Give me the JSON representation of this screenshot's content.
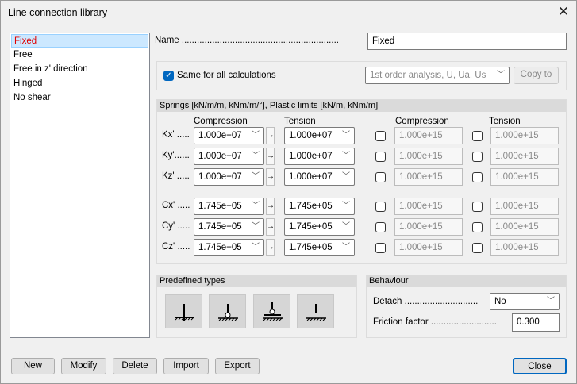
{
  "window": {
    "title": "Line connection library"
  },
  "list": {
    "items": [
      "Fixed",
      "Free",
      "Free in z' direction",
      "Hinged",
      "No shear"
    ],
    "selected": 0
  },
  "name": {
    "label": "Name ..............................................................",
    "value": "Fixed"
  },
  "calc": {
    "same_label": "Same for all calculations",
    "same_checked": true,
    "analysis": "1st order analysis, U, Ua, Us",
    "copy_to": "Copy to"
  },
  "springs": {
    "header": "Springs [kN/m/m, kNm/m/°], Plastic limits [kN/m, kNm/m]",
    "col_compression": "Compression",
    "col_tension": "Tension",
    "col_limit_compression": "Compression",
    "col_limit_tension": "Tension",
    "arrow": "→",
    "rows": [
      {
        "label": "Kx' .....",
        "compression": "1.000e+07",
        "tension": "1.000e+07",
        "limit_compression": "1.000e+15",
        "limit_tension": "1.000e+15"
      },
      {
        "label": "Ky'......",
        "compression": "1.000e+07",
        "tension": "1.000e+07",
        "limit_compression": "1.000e+15",
        "limit_tension": "1.000e+15"
      },
      {
        "label": "Kz' .....",
        "compression": "1.000e+07",
        "tension": "1.000e+07",
        "limit_compression": "1.000e+15",
        "limit_tension": "1.000e+15"
      },
      {
        "label": "Cx' .....",
        "compression": "1.745e+05",
        "tension": "1.745e+05",
        "limit_compression": "1.000e+15",
        "limit_tension": "1.000e+15"
      },
      {
        "label": "Cy' .....",
        "compression": "1.745e+05",
        "tension": "1.745e+05",
        "limit_compression": "1.000e+15",
        "limit_tension": "1.000e+15"
      },
      {
        "label": "Cz' .....",
        "compression": "1.745e+05",
        "tension": "1.745e+05",
        "limit_compression": "1.000e+15",
        "limit_tension": "1.000e+15"
      }
    ]
  },
  "predefined": {
    "header": "Predefined types",
    "types": [
      "fixed-support-icon",
      "hinged-support-icon",
      "roller-support-icon",
      "free-support-icon"
    ]
  },
  "behaviour": {
    "header": "Behaviour",
    "detach_label": "Detach .............................",
    "detach_value": "No",
    "friction_label": "Friction factor ..........................",
    "friction_value": "0.300"
  },
  "buttons": {
    "new": "New",
    "modify": "Modify",
    "delete": "Delete",
    "import": "Import",
    "export": "Export",
    "close": "Close"
  }
}
